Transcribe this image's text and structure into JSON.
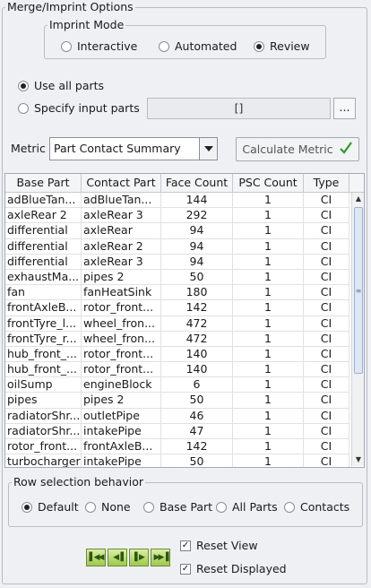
{
  "title": "Merge/Imprint Options",
  "imprint_mode": {
    "label": "Imprint Mode",
    "options": [
      {
        "label": "Interactive",
        "selected": false
      },
      {
        "label": "Automated",
        "selected": false
      },
      {
        "label": "Review",
        "selected": true
      }
    ]
  },
  "parts": {
    "use_all_label": "Use all parts",
    "use_all_selected": true,
    "specify_label": "Specify input parts",
    "specify_selected": false,
    "input_value": "[]",
    "browse_label": "..."
  },
  "metric": {
    "label": "Metric",
    "selected": "Part Contact Summary",
    "calculate_label": "Calculate Metric",
    "calculate_icon": "check-icon",
    "check_color": "#2e9a2e"
  },
  "table": {
    "headers": [
      "Base Part",
      "Contact Part",
      "Face Count",
      "PSC Count",
      "Type"
    ],
    "rows": [
      [
        "adBlueTan...",
        "adBlueTan...",
        "144",
        "1",
        "CI"
      ],
      [
        "axleRear 2",
        "axleRear 3",
        "292",
        "1",
        "CI"
      ],
      [
        "differential",
        "axleRear",
        "94",
        "1",
        "CI"
      ],
      [
        "differential",
        "axleRear 2",
        "94",
        "1",
        "CI"
      ],
      [
        "differential",
        "axleRear 3",
        "94",
        "1",
        "CI"
      ],
      [
        "exhaustMa...",
        "pipes 2",
        "50",
        "1",
        "CI"
      ],
      [
        "fan",
        "fanHeatSink",
        "180",
        "1",
        "CI"
      ],
      [
        "frontAxleB...",
        "rotor_front...",
        "142",
        "1",
        "CI"
      ],
      [
        "frontTyre_l...",
        "wheel_fron...",
        "472",
        "1",
        "CI"
      ],
      [
        "frontTyre_r...",
        "wheel_fron...",
        "472",
        "1",
        "CI"
      ],
      [
        "hub_front_...",
        "rotor_front...",
        "140",
        "1",
        "CI"
      ],
      [
        "hub_front_...",
        "rotor_front...",
        "140",
        "1",
        "CI"
      ],
      [
        "oilSump",
        "engineBlock",
        "6",
        "1",
        "CI"
      ],
      [
        "pipes",
        "pipes 2",
        "50",
        "1",
        "CI"
      ],
      [
        "radiatorShr...",
        "outletPipe",
        "46",
        "1",
        "CI"
      ],
      [
        "radiatorShr...",
        "intakePipe",
        "47",
        "1",
        "CI"
      ],
      [
        "rotor_front...",
        "frontAxleB...",
        "142",
        "1",
        "CI"
      ],
      [
        "turbocharger",
        "intakePipe",
        "50",
        "1",
        "CI"
      ]
    ]
  },
  "row_selection": {
    "label": "Row selection behavior",
    "options": [
      {
        "label": "Default",
        "selected": true
      },
      {
        "label": "None",
        "selected": false
      },
      {
        "label": "Base Part",
        "selected": false
      },
      {
        "label": "All Parts",
        "selected": false
      },
      {
        "label": "Contacts",
        "selected": false
      }
    ]
  },
  "navigation": {
    "buttons": [
      "first-icon",
      "previous-icon",
      "next-icon",
      "last-icon"
    ]
  },
  "options": {
    "reset_view_label": "Reset View",
    "reset_view_checked": true,
    "reset_displayed_label": "Reset Displayed",
    "reset_displayed_checked": true
  }
}
